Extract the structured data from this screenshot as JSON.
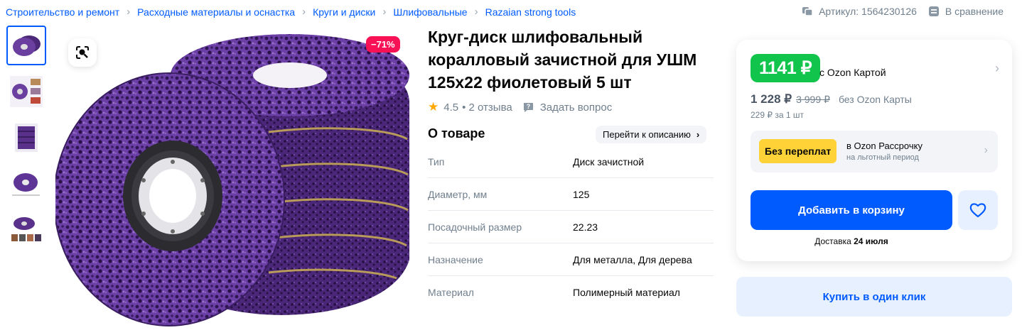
{
  "breadcrumbs": [
    {
      "label": "Строительство и ремонт"
    },
    {
      "label": "Расходные материалы и оснастка"
    },
    {
      "label": "Круги и диски"
    },
    {
      "label": "Шлифовальные"
    },
    {
      "label": "Razaian strong tools"
    }
  ],
  "topbar": {
    "article_label": "Артикул: 1564230126",
    "compare_label": "В сравнение"
  },
  "gallery": {
    "thumb_count": 5,
    "active_index": 0,
    "discount_badge": "−71%"
  },
  "product": {
    "title": "Круг-диск шлифовальный коралловый зачистной для УШМ 125х22 фиолетовый 5 шт",
    "rating": "4.5",
    "reviews": "• 2 отзыва",
    "ask_question": "Задать вопрос"
  },
  "about": {
    "heading": "О товаре",
    "goto_description": "Перейти к описанию",
    "specs": [
      {
        "key": "Тип",
        "value": "Диск зачистной"
      },
      {
        "key": "Диаметр, мм",
        "value": "125"
      },
      {
        "key": "Посадочный размер",
        "value": "22.23"
      },
      {
        "key": "Назначение",
        "value": "Для металла, Для дерева"
      },
      {
        "key": "Материал",
        "value": "Полимерный материал"
      }
    ]
  },
  "buy_card": {
    "card_price": "1141 ₽",
    "card_price_label": "с Ozon Картой",
    "price": "1 228 ₽",
    "old_price": "3 999 ₽",
    "price_label": "без Ozon Карты",
    "per_unit": "229 ₽ за 1 шт",
    "installment_badge": "Без переплат",
    "installment_title": "в Ozon Рассрочку",
    "installment_subtitle": "на льготный период",
    "add_to_cart": "Добавить в корзину",
    "delivery_prefix": "Доставка",
    "delivery_date": "24 июля",
    "buy_one_click": "Купить в один клик"
  },
  "colors": {
    "accent": "#005bff",
    "green": "#10c44c",
    "discount": "#f91155",
    "installment": "#ffd338",
    "product": "#5a2d8c"
  }
}
